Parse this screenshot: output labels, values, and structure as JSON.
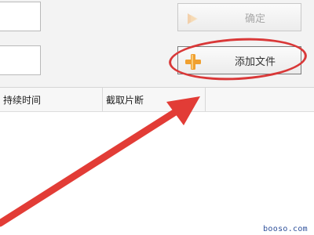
{
  "buttons": {
    "confirm_label": "确定",
    "add_file_label": "添加文件"
  },
  "table": {
    "columns": [
      "持续时间",
      "截取片断",
      ""
    ]
  },
  "annotation": {
    "color": "#d93838"
  },
  "watermark": "booso.com"
}
